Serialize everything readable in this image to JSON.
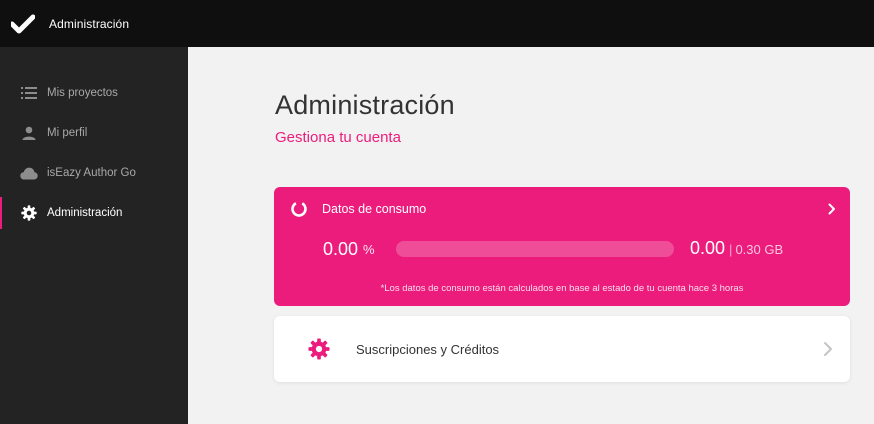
{
  "topbar": {
    "title": "Administración",
    "logo_icon": "checkmark-logo"
  },
  "sidebar": {
    "items": [
      {
        "label": "Mis proyectos",
        "icon": "list-icon",
        "active": false
      },
      {
        "label": "Mi perfil",
        "icon": "person-icon",
        "active": false
      },
      {
        "label": "isEazy Author Go",
        "icon": "cloud-icon",
        "active": false
      },
      {
        "label": "Administración",
        "icon": "gear-icon",
        "active": true
      }
    ]
  },
  "main": {
    "title": "Administración",
    "subtitle": "Gestiona tu cuenta",
    "usage": {
      "title": "Datos de consumo",
      "percent_value": "0.00",
      "percent_unit": "%",
      "progress_fraction": 0.0,
      "used_value": "0.00",
      "separator": "|",
      "total_value": "0.30 GB",
      "note": "*Los datos de consumo están calculados en base al estado de tu cuenta hace 3 horas"
    },
    "subscriptions": {
      "label": "Suscripciones y Créditos"
    }
  },
  "colors": {
    "accent": "#ec1c7d",
    "topbar": "#0f0f0f",
    "sidebar": "#232323",
    "background": "#f2f2f2"
  }
}
